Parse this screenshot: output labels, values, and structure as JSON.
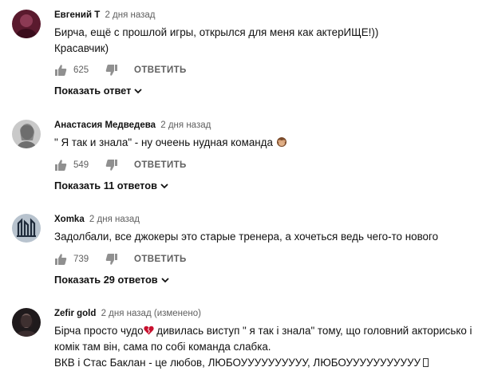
{
  "ui": {
    "reply_label": "ОТВЕТИТЬ"
  },
  "comments": [
    {
      "author": "Евгений Т",
      "time": "2 дня назад",
      "text_line1": "Бирча, ещё с прошлой игры, открылся для меня как актерИЩЕ!))",
      "text_line2": "Красавчик)",
      "likes": "625",
      "replies_label": "Показать ответ"
    },
    {
      "author": "Анастасия Медведева",
      "time": "2 дня назад",
      "text_line1": "\" Я так и знала\" - ну очеень нудная команда",
      "likes": "549",
      "replies_label": "Показать 11 ответов"
    },
    {
      "author": "Xomka",
      "time": "2 дня назад",
      "text_line1": "Задолбали, все джокеры это старые тренера, а хочеться ведь чего-то нового",
      "likes": "739",
      "replies_label": "Показать 29 ответов"
    },
    {
      "author": "Zefir gold",
      "time": "2 дня назад (изменено)",
      "text_line1_a": "Бірча просто чудо",
      "text_line1_b": " дивилась виступ \" я так і знала\" тому, що головний акторисько і",
      "text_line2": "комік там він,  сама по собі команда слабка.",
      "text_line3": "ВКВ і Стас Баклан  - це любов, ЛЮБОУУУУУУУУУУ, ЛЮБОУУУУУУУУУУУ"
    }
  ],
  "icons": {
    "like": "thumbs-up-icon",
    "dislike": "thumbs-down-icon",
    "chevron": "chevron-down-icon",
    "monkey": "see-no-evil-monkey-emoji",
    "heart": "broken-heart-emoji"
  },
  "colors": {
    "text": "#111111",
    "meta": "#606060",
    "heart": "#c8102e"
  }
}
